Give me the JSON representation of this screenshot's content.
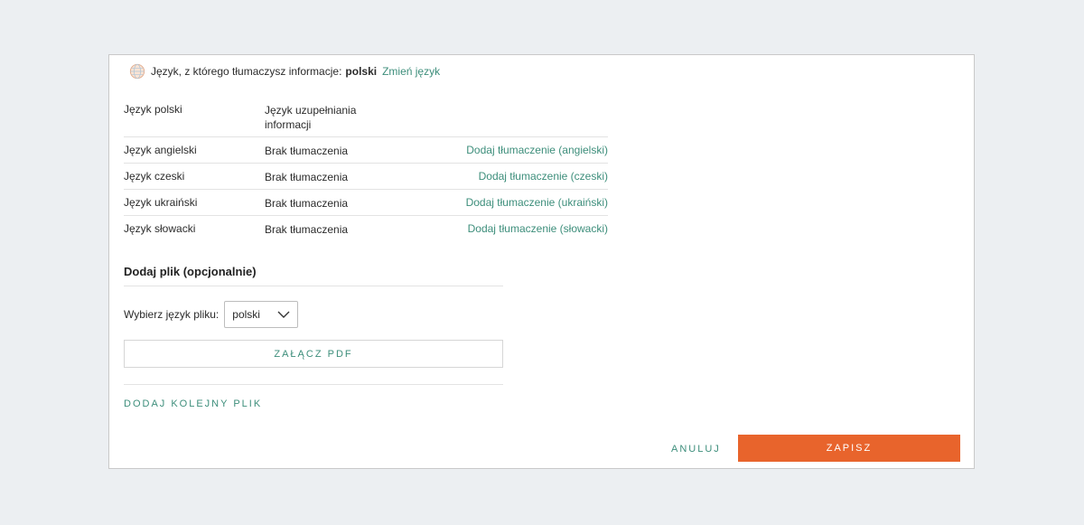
{
  "source_language": {
    "label": "Język, z którego tłumaczysz informacje:",
    "value": "polski",
    "change_link": "Zmień język"
  },
  "translations": {
    "header": {
      "language": "Język polski",
      "status": "Język uzupełniania informacji"
    },
    "rows": [
      {
        "language": "Język angielski",
        "status": "Brak tłumaczenia",
        "action": "Dodaj tłumaczenie (angielski)"
      },
      {
        "language": "Język czeski",
        "status": "Brak tłumaczenia",
        "action": "Dodaj tłumaczenie (czeski)"
      },
      {
        "language": "Język ukraiński",
        "status": "Brak tłumaczenia",
        "action": "Dodaj tłumaczenie (ukraiński)"
      },
      {
        "language": "Język słowacki",
        "status": "Brak tłumaczenia",
        "action": "Dodaj tłumaczenie (słowacki)"
      }
    ]
  },
  "file_section": {
    "title": "Dodaj plik (opcjonalnie)",
    "language_label": "Wybierz język pliku:",
    "language_value": "polski",
    "attach_label": "ZAŁĄCZ PDF",
    "add_another_label": "DODAJ KOLEJNY PLIK"
  },
  "footer": {
    "cancel_label": "ANULUJ",
    "save_label": "ZAPISZ"
  },
  "colors": {
    "accent": "#3d8e7b",
    "primary_button": "#e8642c",
    "page_background": "#eceff2"
  },
  "icons": {
    "language": "globe-icon",
    "dropdown": "chevron-down-icon"
  }
}
